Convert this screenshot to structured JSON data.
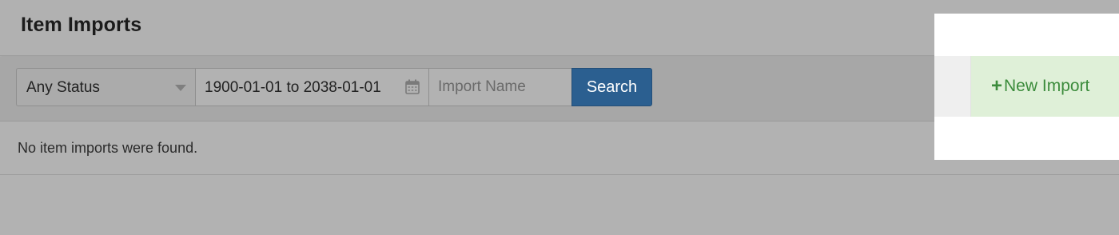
{
  "header": {
    "title": "Item Imports"
  },
  "filters": {
    "status_value": "Any Status",
    "date_range_value": "1900-01-01 to 2038-01-01",
    "name_placeholder": "Import Name",
    "search_label": "Search"
  },
  "actions": {
    "new_import_label": "New Import",
    "new_import_icon": "plus-icon",
    "plus_glyph": "+"
  },
  "content": {
    "empty_message": "No item imports were found."
  },
  "colors": {
    "primary_button": "#2b5f90",
    "success_bg": "#dff0d8",
    "success_text": "#3c8c3c",
    "overlay_bg": "#b2b2b2"
  }
}
